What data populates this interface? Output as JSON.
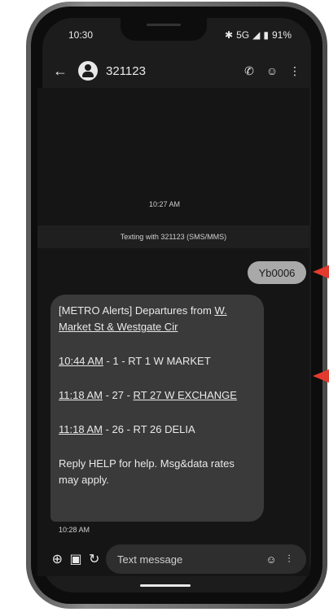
{
  "status": {
    "time": "10:30",
    "network": "5G",
    "battery": "91%"
  },
  "header": {
    "contact": "321123"
  },
  "messages": {
    "timestamp_top": "10:27 AM",
    "texting_with": "Texting with 321123 (SMS/MMS)",
    "outgoing": "Yb0006",
    "incoming": {
      "prefix": "[METRO Alerts] Departures from ",
      "stop_link": "W. Market St & Westgate Cir",
      "line1_time": "10:44 AM",
      "line1_rest": " - 1 - RT 1 W MARKET",
      "line2_time": "11:18 AM",
      "line2_mid": " - 27 - ",
      "line2_route": "RT 27 W EXCHANGE",
      "line3_time": "11:18 AM",
      "line3_rest": " - 26 - RT 26 DELIA",
      "footer": "Reply HELP for help. Msg&data rates may apply."
    },
    "timestamp_bottom": "10:28 AM"
  },
  "compose": {
    "placeholder": "Text message"
  },
  "colors": {
    "accent_arrow": "#e23b2e",
    "background": "#1c1c1c",
    "bubble_in": "#3a3a3a",
    "bubble_out": "#a9a9a9"
  }
}
